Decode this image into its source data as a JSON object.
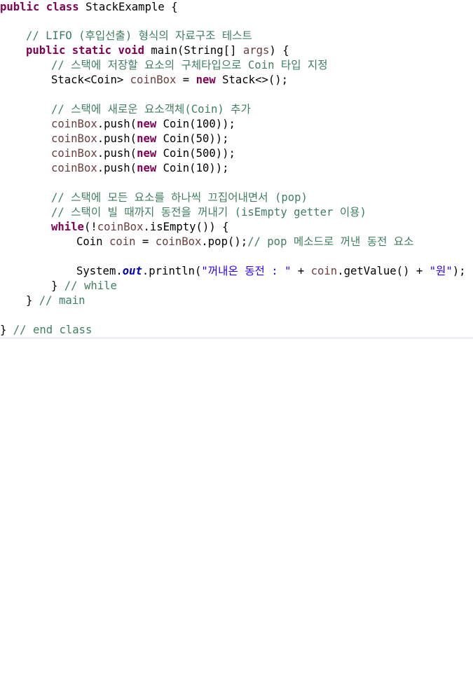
{
  "code": {
    "l1": {
      "kw1": "public",
      "kw2": "class",
      "rest": " StackExample {"
    },
    "l2": {
      "comment": "// LIFO (후입선출) 형식의 자료구조 테스트"
    },
    "l3": {
      "kw1": "public",
      "kw2": "static",
      "kw3": "void",
      "rest": " main(String[] ",
      "param": "args",
      "end": ") {"
    },
    "l4": {
      "comment": "// 스택에 저장할 요소의 구체타입으로 Coin 타입 지정"
    },
    "l5": {
      "type": "Stack<Coin> ",
      "var": "coinBox",
      "mid": " = ",
      "kw": "new",
      "end": " Stack<>();"
    },
    "l6": {
      "comment": "// 스택에 새로운 요소객체(Coin) 추가"
    },
    "pushes": [
      {
        "var": "coinBox",
        "call": ".push(",
        "kw": "new",
        "rest": " Coin(100));"
      },
      {
        "var": "coinBox",
        "call": ".push(",
        "kw": "new",
        "rest": " Coin(50));"
      },
      {
        "var": "coinBox",
        "call": ".push(",
        "kw": "new",
        "rest": " Coin(500));"
      },
      {
        "var": "coinBox",
        "call": ".push(",
        "kw": "new",
        "rest": " Coin(10));"
      }
    ],
    "l11": {
      "comment": "// 스택에 모든 요소를 하나씩 끄집어내면서 (pop)"
    },
    "l12": {
      "comment": "// 스택이 빌 때까지 동전을 꺼내기 (isEmpty getter 이용)"
    },
    "l13": {
      "kw": "while",
      "open": "(!",
      "var": "coinBox",
      "rest": ".isEmpty()) {"
    },
    "l14": {
      "type": "Coin ",
      "var": "coin",
      "mid": " = ",
      "var2": "coinBox",
      "call": ".pop();",
      "comment": "// pop 메소드로 꺼낸 동전 요소"
    },
    "l15": {
      "pre": "System.",
      "field": "out",
      "call": ".println(",
      "str1": "\"꺼내온 동전 : \"",
      "plus1": " + ",
      "var": "coin",
      "getter": ".getValue() + ",
      "str2": "\"원\"",
      "end": ");"
    },
    "l16": {
      "brace": "} ",
      "comment": "// while"
    },
    "l17": {
      "brace": "} ",
      "comment": "// main"
    },
    "l18": {
      "brace": "} ",
      "comment": "// end class"
    }
  },
  "colors": {
    "keyword": "#7f0055",
    "comment": "#3f7f5f",
    "variable": "#6a3e3e",
    "string": "#2a00ff",
    "static_field": "#0000c0"
  }
}
